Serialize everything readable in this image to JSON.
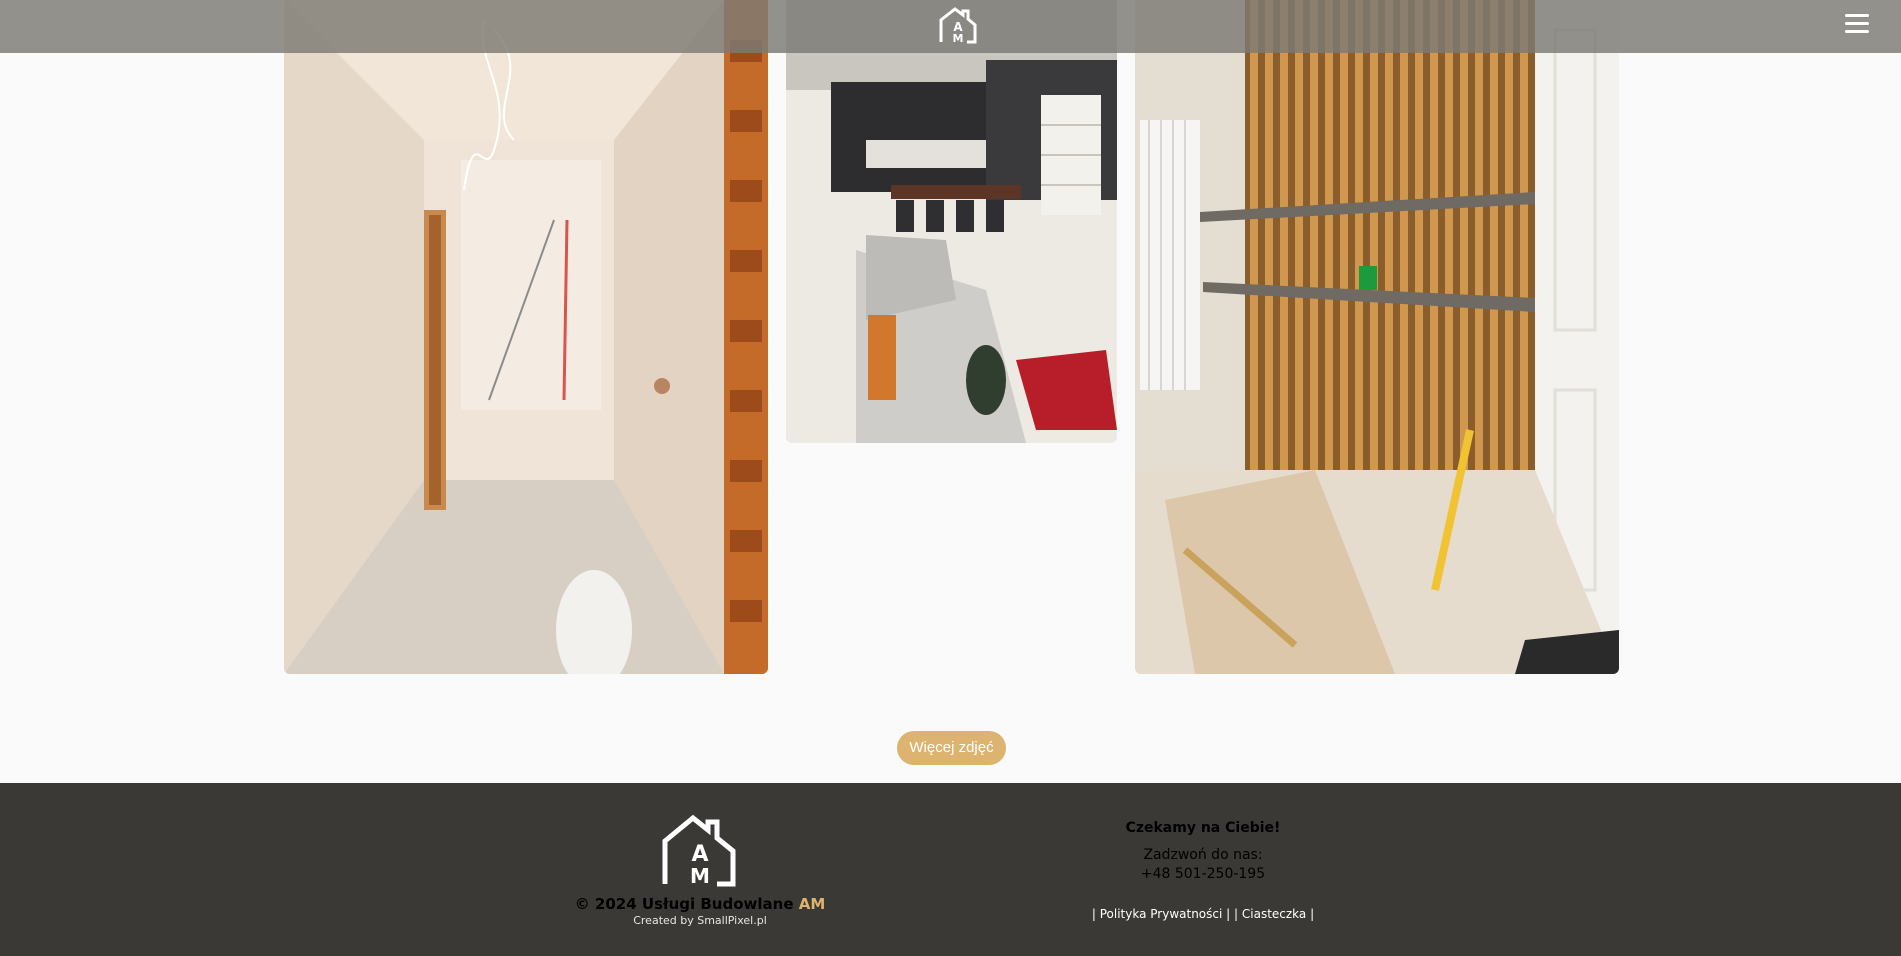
{
  "header": {
    "logo_icon": "am-house-logo-icon",
    "menu_icon": "hamburger-menu-icon"
  },
  "gallery": {
    "photos": [
      {
        "subject": "hall",
        "description": "corridor under renovation"
      },
      {
        "subject": "living",
        "description": "finished living room and kitchen"
      },
      {
        "subject": "wall",
        "description": "wooden slat wall with shelves"
      }
    ],
    "more_button": "Więcej zdjęć"
  },
  "footer": {
    "copyright_prefix": "© 2024",
    "company_name": "Usługi Budowlane",
    "company_accent": "AM",
    "created_by": "Created by SmallPixel.pl",
    "contact_title": "Czekamy na Ciebie!",
    "contact_label": "Zadzwoń do nas:",
    "phone": "+48 501-250-195",
    "privacy_link": "| Polityka Prywatności |",
    "cookies_link": "| Ciasteczka |"
  },
  "colors": {
    "accent": "#dcb36f",
    "footer_bg": "#3b3935",
    "header_bg": "#7d7a74"
  }
}
